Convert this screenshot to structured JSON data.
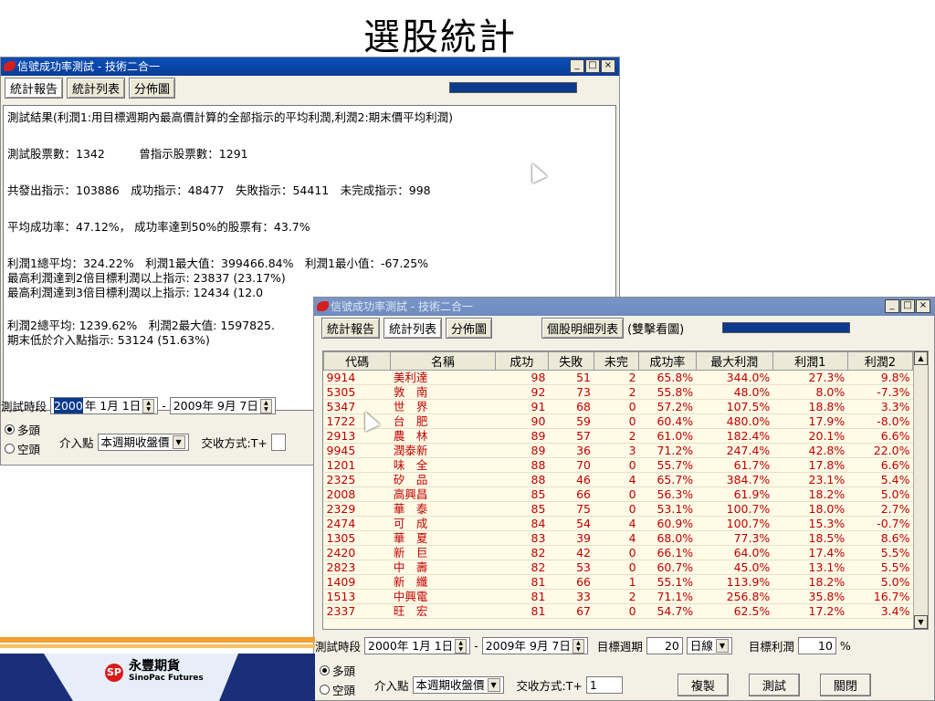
{
  "slide_title": "選股統計",
  "back_window": {
    "title": "信號成功率測試 - 技術二合一",
    "tabs": [
      "統計報告",
      "統計列表",
      "分佈圖"
    ],
    "report_lines": [
      "測試結果(利潤1:用目標週期內最高價計算的全部指示的平均利潤,利潤2:期末價平均利潤)",
      "測試股票數：1342　　　曾指示股票數：1291",
      "共發出指示：103886　成功指示：48477　失敗指示：54411　未完成指示：998",
      "平均成功率：47.12%， 成功率達到50%的股票有：43.7%",
      "利潤1總平均：324.22%　利潤1最大值：399466.84%　利潤1最小值：-67.25%",
      "最高利潤達到2倍目標利潤以上指示: 23837 (23.17%)",
      "最高利潤達到3倍目標利潤以上指示: 12434 (12.0",
      "利潤2總平均: 1239.62%　利潤2最大值: 1597825.",
      "期末低於介入點指示: 53124 (51.63%)"
    ],
    "period_label": "測試時段",
    "start_date_year": "2000",
    "start_date_rest": "年 1月 1日",
    "dash": "-",
    "end_date": "2009年 9月 7日",
    "radio_long": "多頭",
    "radio_short": "空頭",
    "entry_label": "介入點",
    "entry_value": "本週期收盤價",
    "trade_label": "交收方式:T+"
  },
  "front_window": {
    "title": "信號成功率測試 - 技術二合一",
    "tabs": [
      "統計報告",
      "統計列表",
      "分佈圖"
    ],
    "detail_button": "個股明細列表",
    "detail_note": "(雙擊看圖)",
    "columns": [
      "代碼",
      "名稱",
      "成功",
      "失敗",
      "未完",
      "成功率",
      "最大利潤",
      "利潤1",
      "利潤2"
    ],
    "rows": [
      [
        "9914",
        "美利達",
        "98",
        "51",
        "2",
        "65.8%",
        "344.0%",
        "27.3%",
        "9.8%"
      ],
      [
        "5305",
        "敦　南",
        "92",
        "73",
        "2",
        "55.8%",
        "48.0%",
        "8.0%",
        "-7.3%"
      ],
      [
        "5347",
        "世　界",
        "91",
        "68",
        "0",
        "57.2%",
        "107.5%",
        "18.8%",
        "3.3%"
      ],
      [
        "1722",
        "台　肥",
        "90",
        "59",
        "0",
        "60.4%",
        "480.0%",
        "17.9%",
        "-8.0%"
      ],
      [
        "2913",
        "農　林",
        "89",
        "57",
        "2",
        "61.0%",
        "182.4%",
        "20.1%",
        "6.6%"
      ],
      [
        "9945",
        "潤泰新",
        "89",
        "36",
        "3",
        "71.2%",
        "247.4%",
        "42.8%",
        "22.0%"
      ],
      [
        "1201",
        "味　全",
        "88",
        "70",
        "0",
        "55.7%",
        "61.7%",
        "17.8%",
        "6.6%"
      ],
      [
        "2325",
        "矽　品",
        "88",
        "46",
        "4",
        "65.7%",
        "384.7%",
        "23.1%",
        "5.4%"
      ],
      [
        "2008",
        "高興昌",
        "85",
        "66",
        "0",
        "56.3%",
        "61.9%",
        "18.2%",
        "5.0%"
      ],
      [
        "2329",
        "華　泰",
        "85",
        "75",
        "0",
        "53.1%",
        "100.7%",
        "18.0%",
        "2.7%"
      ],
      [
        "2474",
        "可　成",
        "84",
        "54",
        "4",
        "60.9%",
        "100.7%",
        "15.3%",
        "-0.7%"
      ],
      [
        "1305",
        "華　夏",
        "83",
        "39",
        "4",
        "68.0%",
        "77.3%",
        "18.5%",
        "8.6%"
      ],
      [
        "2420",
        "新　巨",
        "82",
        "42",
        "0",
        "66.1%",
        "64.0%",
        "17.4%",
        "5.5%"
      ],
      [
        "2823",
        "中　壽",
        "82",
        "53",
        "0",
        "60.7%",
        "45.0%",
        "13.1%",
        "5.5%"
      ],
      [
        "1409",
        "新　纖",
        "81",
        "66",
        "1",
        "55.1%",
        "113.9%",
        "18.2%",
        "5.0%"
      ],
      [
        "1513",
        "中興電",
        "81",
        "33",
        "2",
        "71.1%",
        "256.8%",
        "35.8%",
        "16.7%"
      ],
      [
        "2337",
        "旺　宏",
        "81",
        "67",
        "0",
        "54.7%",
        "62.5%",
        "17.2%",
        "3.4%"
      ]
    ],
    "period_label": "測試時段",
    "start_date": "2000年 1月 1日",
    "dash": "-",
    "end_date": "2009年 9月 7日",
    "target_period_label": "目標週期",
    "target_period_value": "20",
    "period_unit": "日線",
    "target_profit_label": "目標利潤",
    "target_profit_value": "10",
    "target_profit_unit": "%",
    "radio_long": "多頭",
    "radio_short": "空頭",
    "entry_label": "介入點",
    "entry_value": "本週期收盤價",
    "trade_label": "交收方式:T+",
    "trade_value": "1",
    "copy_button": "複製",
    "test_button": "測試",
    "close_button": "關閉"
  },
  "window_buttons": {
    "minimize": "_",
    "maximize": "□",
    "close": "×"
  },
  "logo": {
    "name": "永豐期貨",
    "sub": "SinoPac Futures",
    "mark": "SP"
  },
  "colors": {
    "titlebar": "#0b4fb8",
    "grid_text": "#c00000",
    "grid_bg": "#fffbe6",
    "stripe_orange": "#f0a030",
    "stripe_blue": "#1a2f7a"
  }
}
